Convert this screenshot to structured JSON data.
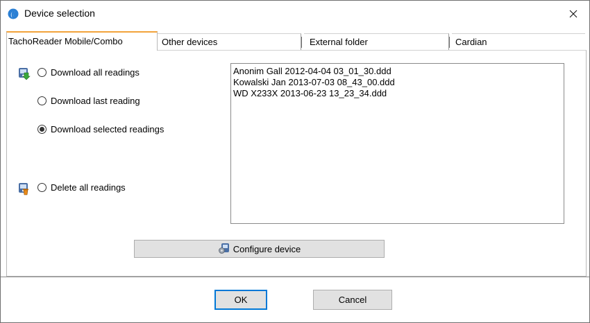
{
  "window": {
    "title": "Device selection"
  },
  "tabs": [
    {
      "label": "TachoReader Mobile/Combo",
      "active": true
    },
    {
      "label": "Other devices",
      "active": false
    },
    {
      "label": "External folder",
      "active": false
    },
    {
      "label": "Cardian",
      "active": false
    }
  ],
  "options": {
    "download_all": "Download all readings",
    "download_last": "Download last reading",
    "download_selected": "Download selected readings",
    "delete_all": "Delete all readings",
    "selected": "download_selected"
  },
  "files": [
    "Anonim Gall 2012-04-04 03_01_30.ddd",
    "Kowalski Jan 2013-07-03 08_43_00.ddd",
    "WD X233X 2013-06-23 13_23_34.ddd"
  ],
  "buttons": {
    "configure": "Configure device",
    "ok": "OK",
    "cancel": "Cancel"
  },
  "colors": {
    "active_tab_accent": "#f2a33a",
    "default_button_border": "#0078d7"
  }
}
